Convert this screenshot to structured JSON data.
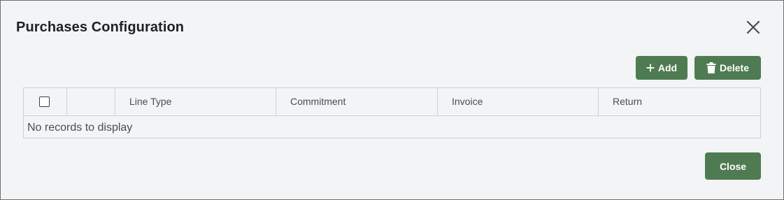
{
  "dialog": {
    "title": "Purchases Configuration",
    "close_icon": "close-icon"
  },
  "toolbar": {
    "add_label": "Add",
    "add_icon": "plus-icon",
    "delete_label": "Delete",
    "delete_icon": "trash-icon"
  },
  "grid": {
    "columns": [
      "",
      "",
      "Line Type",
      "Commitment",
      "Invoice",
      "Return"
    ],
    "rows": [],
    "empty_message": "No records to display"
  },
  "footer": {
    "close_label": "Close"
  },
  "colors": {
    "accent": "#4f7b52",
    "background": "#f3f4f6",
    "border": "#cfd1d4"
  }
}
